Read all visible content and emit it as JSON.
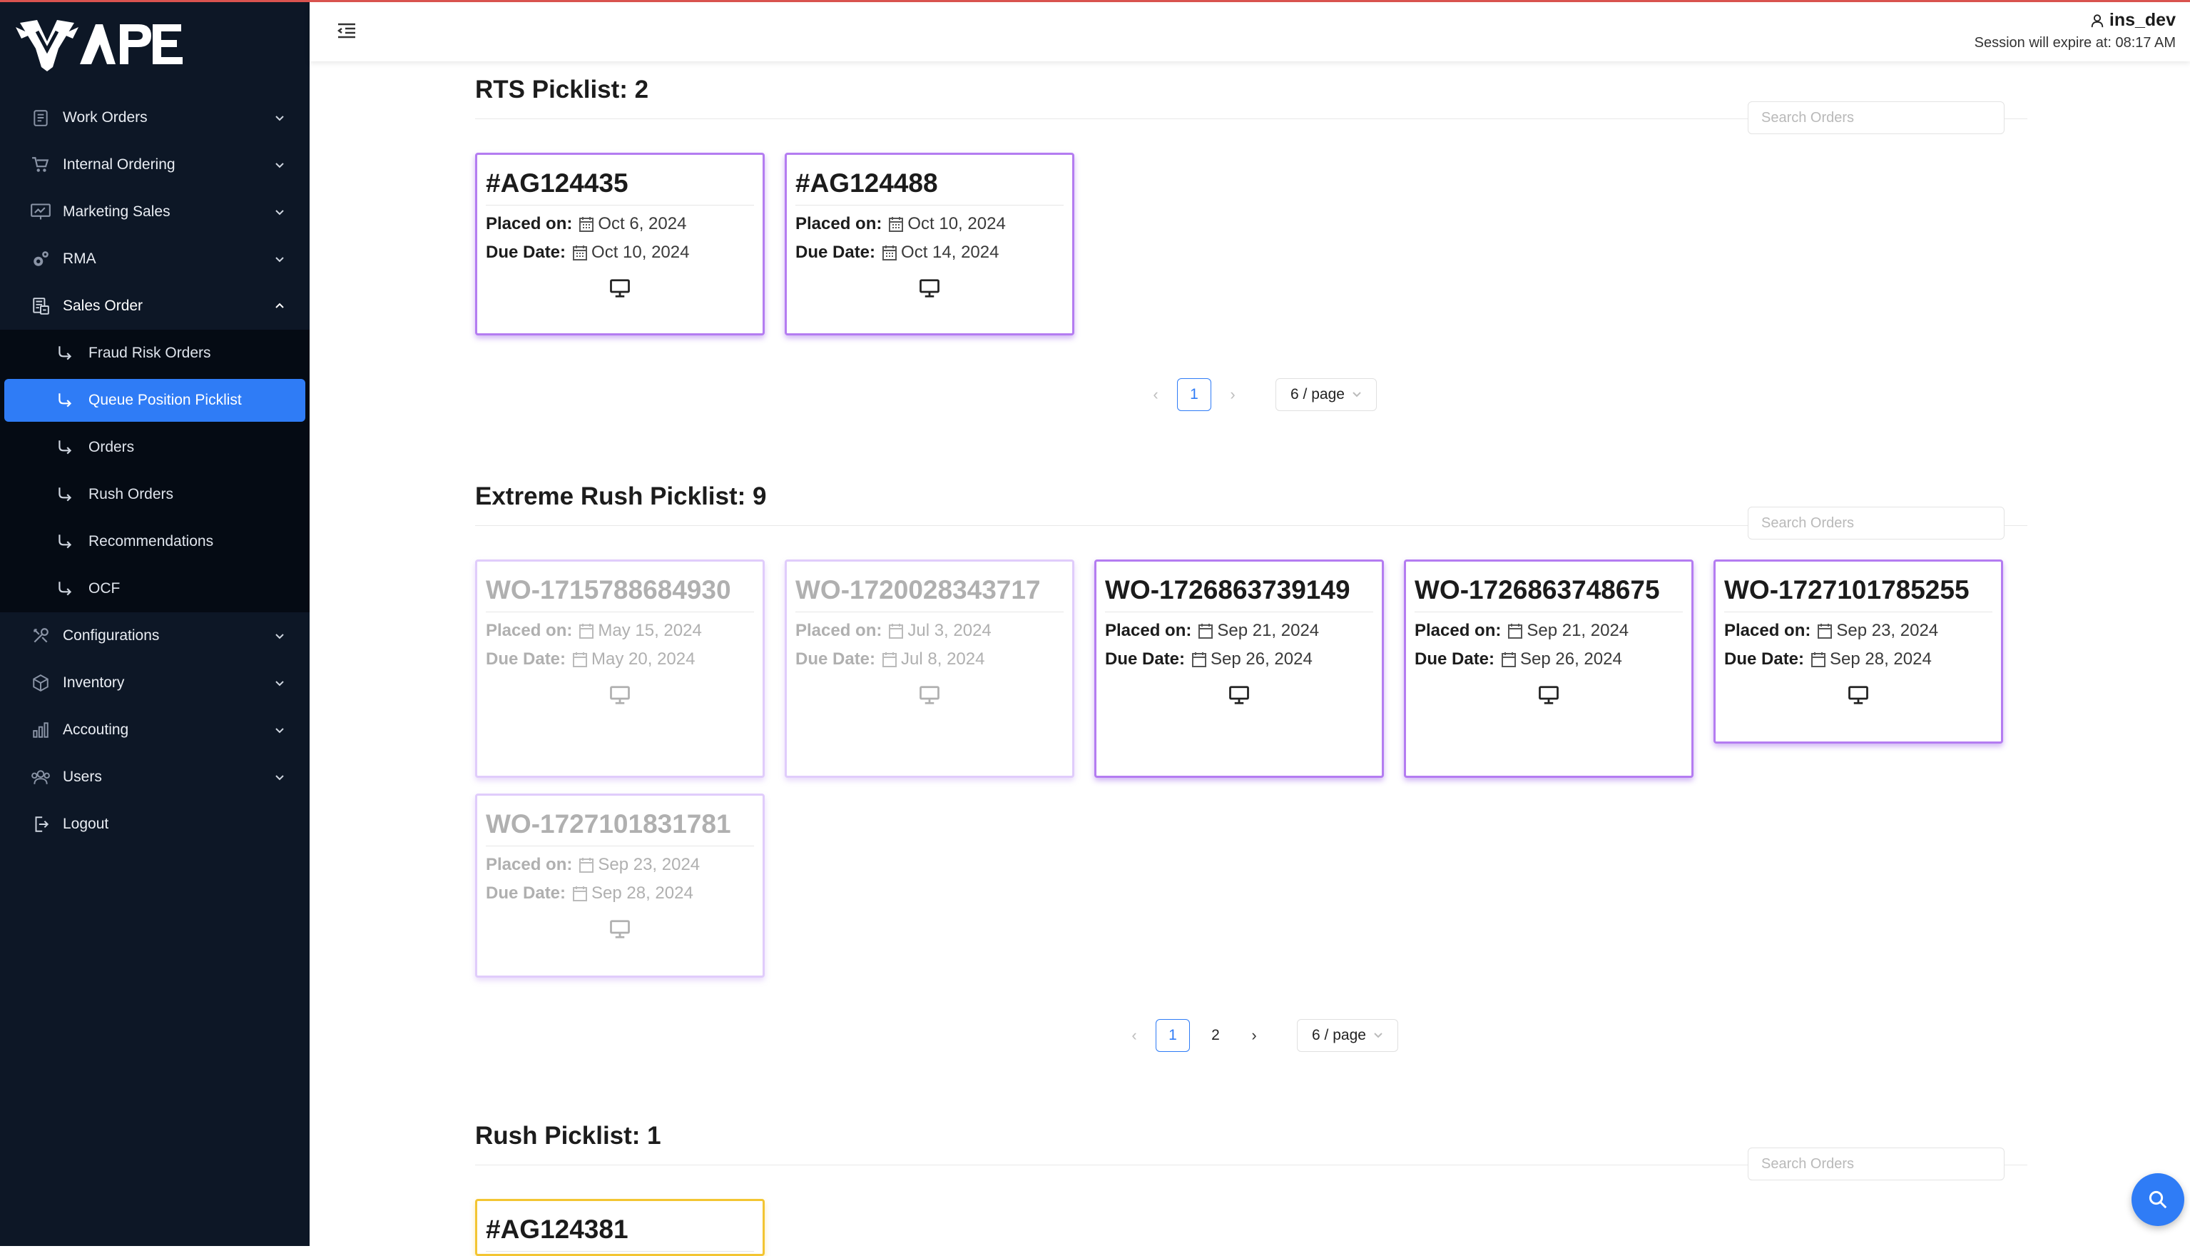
{
  "brand": {
    "logo_text": "APEX"
  },
  "header": {
    "username": "ins_dev",
    "session": "Session will expire at: 08:17 AM"
  },
  "sidebar": {
    "items": [
      {
        "label": "Work Orders",
        "icon": "clipboard-icon"
      },
      {
        "label": "Internal Ordering",
        "icon": "cart-icon"
      },
      {
        "label": "Marketing Sales",
        "icon": "chart-board-icon"
      },
      {
        "label": "RMA",
        "icon": "gears-icon"
      },
      {
        "label": "Sales Order",
        "icon": "sales-order-icon"
      }
    ],
    "sub_items": [
      {
        "label": "Fraud Risk Orders"
      },
      {
        "label": "Queue Position Picklist"
      },
      {
        "label": "Orders"
      },
      {
        "label": "Rush Orders"
      },
      {
        "label": "Recommendations"
      },
      {
        "label": "OCF"
      }
    ],
    "items_after": [
      {
        "label": "Configurations",
        "icon": "tools-icon"
      },
      {
        "label": "Inventory",
        "icon": "inventory-icon"
      },
      {
        "label": "Accouting",
        "icon": "bar-chart-icon"
      },
      {
        "label": "Users",
        "icon": "users-icon"
      },
      {
        "label": "Logout",
        "icon": "logout-icon"
      }
    ]
  },
  "labels": {
    "placed": "Placed on:",
    "due": "Due Date:",
    "search_placeholder": "Search Orders",
    "page_size": "6 / page"
  },
  "sections": [
    {
      "title": "RTS Picklist: 2",
      "cards": [
        {
          "id": "#AG124435",
          "placed": "Oct 6, 2024",
          "due": "Oct 10, 2024"
        },
        {
          "id": "#AG124488",
          "placed": "Oct 10, 2024",
          "due": "Oct 14, 2024"
        }
      ],
      "pages": [
        "1"
      ]
    },
    {
      "title": "Extreme Rush Picklist: 9",
      "cards": [
        {
          "id": "WO-1715788684930",
          "placed": "May 15, 2024",
          "due": "May 20, 2024"
        },
        {
          "id": "WO-1720028343717",
          "placed": "Jul 3, 2024",
          "due": "Jul 8, 2024"
        },
        {
          "id": "WO-1726863739149",
          "placed": "Sep 21, 2024",
          "due": "Sep 26, 2024"
        },
        {
          "id": "WO-1726863748675",
          "placed": "Sep 21, 2024",
          "due": "Sep 26, 2024"
        },
        {
          "id": "WO-1727101785255",
          "placed": "Sep 23, 2024",
          "due": "Sep 28, 2024"
        },
        {
          "id": "WO-1727101831781",
          "placed": "Sep 23, 2024",
          "due": "Sep 28, 2024"
        }
      ],
      "pages": [
        "1",
        "2"
      ]
    },
    {
      "title": "Rush Picklist: 1",
      "cards": [
        {
          "id": "#AG124381"
        }
      ]
    }
  ]
}
